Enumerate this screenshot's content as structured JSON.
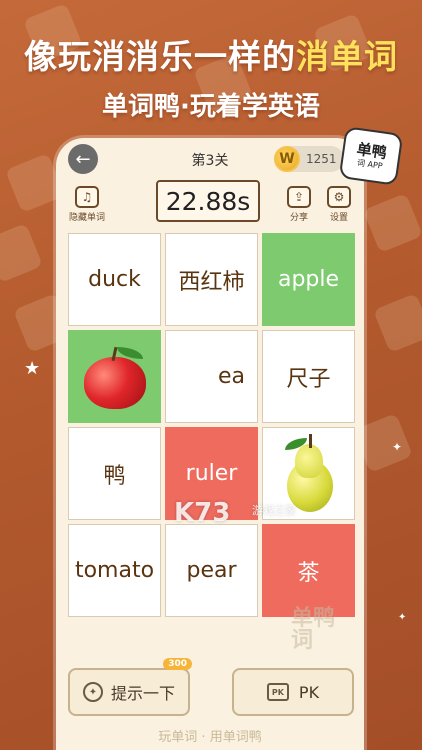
{
  "promo": {
    "headline_before": "像玩消消乐一样的",
    "headline_highlight": "消单词",
    "subline": "单词鸭·玩着学英语"
  },
  "game": {
    "level": "第3关",
    "coins": "1251",
    "timer": "22.88s",
    "logo_line1": "单鸭",
    "logo_line2": "词 APP",
    "tools": [
      {
        "label": "隐藏单词",
        "icon": "headphones-icon"
      },
      {
        "label": "分享",
        "icon": "share-icon"
      },
      {
        "label": "设置",
        "icon": "settings-icon"
      }
    ],
    "cards": [
      {
        "text": "duck",
        "state": "normal"
      },
      {
        "text": "西红柿",
        "state": "normal"
      },
      {
        "text": "apple",
        "state": "green"
      },
      {
        "text": "",
        "state": "green",
        "image": "apple"
      },
      {
        "text": "",
        "state": "normal",
        "image": "blank"
      },
      {
        "text": "尺子",
        "state": "normal"
      },
      {
        "text": "鸭",
        "state": "normal"
      },
      {
        "text": "ruler",
        "state": "red"
      },
      {
        "text": "",
        "state": "normal",
        "image": "pear"
      },
      {
        "text": "tomato",
        "state": "normal"
      },
      {
        "text": "pear",
        "state": "normal"
      },
      {
        "text": "茶",
        "state": "red"
      }
    ],
    "hint_label": "提示一下",
    "hint_cost": "300",
    "pk_label": "PK",
    "footer_note": "玩单词 · 用单词鸭",
    "watermark": "K73",
    "watermark_small": "游戏之家",
    "watermark_tail": "ea",
    "corner_mark": "单鸭词"
  },
  "colors": {
    "correct": "#7dca6f",
    "wrong": "#ee6b5e",
    "highlight": "#ffe15c"
  }
}
